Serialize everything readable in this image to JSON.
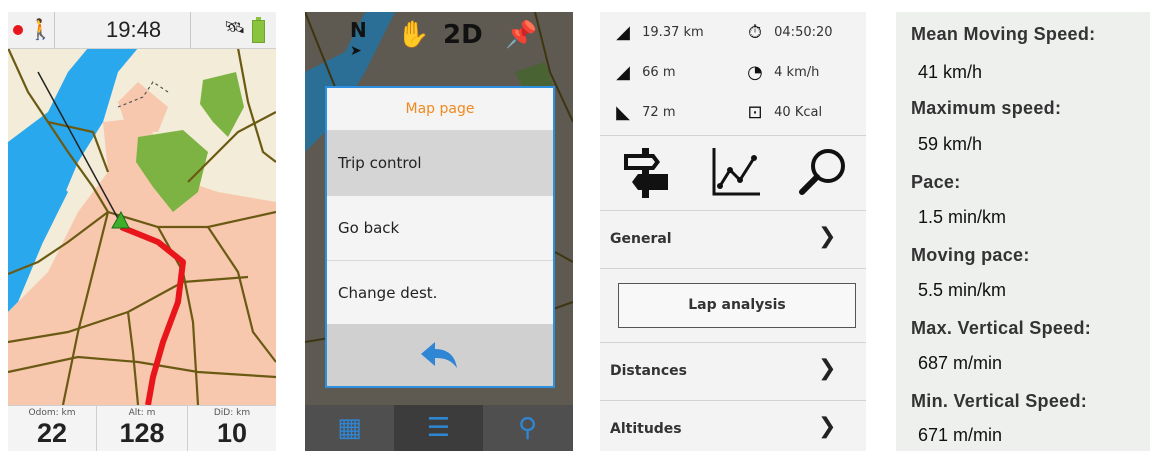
{
  "panel1": {
    "time": "19:48",
    "icons": {
      "record": "record-dot-icon",
      "activity": "walker-icon",
      "gps": "satellite-icon",
      "battery": "battery-icon"
    },
    "dashboard": [
      {
        "label": "Odom: km",
        "value": "22"
      },
      {
        "label": "Alt: m",
        "value": "128"
      },
      {
        "label": "DiD: km",
        "value": "10"
      }
    ],
    "colors": {
      "route": "#e8161b",
      "water": "#2aa8ee",
      "park": "#7cb342",
      "urban": "#f7c8ad"
    }
  },
  "panel2": {
    "top_icons": [
      "north-arrow-icon",
      "hand-icon",
      "2D",
      "pin-icon"
    ],
    "dialog_title": "Map page",
    "menu_items": [
      "Trip control",
      "Go back",
      "Change dest."
    ],
    "selected_index": 0,
    "bottom_bar": [
      "grid-icon",
      "menu-icon",
      "search-icon"
    ],
    "accent": "#2f86d4",
    "title_color": "#f0891e"
  },
  "panel3": {
    "stats_left": [
      {
        "icon": "distance-icon",
        "value": "19.37 km"
      },
      {
        "icon": "ascent-icon",
        "value": "66 m"
      },
      {
        "icon": "descent-icon",
        "value": "72 m"
      }
    ],
    "stats_right": [
      {
        "icon": "stopwatch-icon",
        "value": "04:50:20"
      },
      {
        "icon": "speedometer-icon",
        "value": "4 km/h"
      },
      {
        "icon": "scale-icon",
        "value": "40 Kcal"
      }
    ],
    "tool_icons": [
      "signpost-icon",
      "chart-icon",
      "magnifier-icon"
    ],
    "rows": [
      "General",
      "Distances",
      "Altitudes"
    ],
    "lap_button": "Lap analysis"
  },
  "panel4": {
    "items": [
      {
        "label": "Mean Moving Speed:",
        "value": "41 km/h"
      },
      {
        "label": "Maximum speed:",
        "value": "59 km/h"
      },
      {
        "label": "Pace:",
        "value": "1.5 min/km"
      },
      {
        "label": "Moving pace:",
        "value": "5.5 min/km"
      },
      {
        "label": "Max. Vertical Speed:",
        "value": "687 m/min"
      },
      {
        "label": "Min. Vertical Speed:",
        "value": "671 m/min"
      }
    ]
  }
}
